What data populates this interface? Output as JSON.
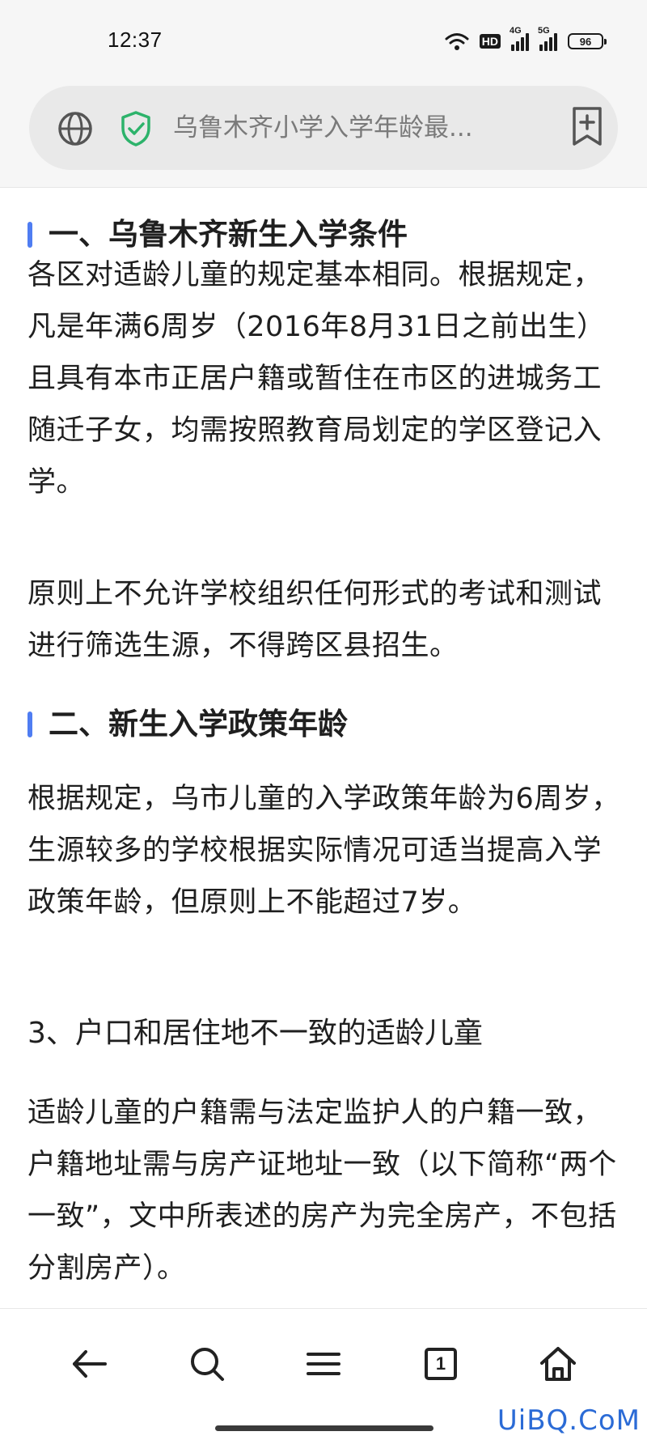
{
  "status_bar": {
    "time": "12:37",
    "hd_badge": "HD",
    "network_1": "4G",
    "network_2": "5G",
    "battery": "96"
  },
  "address_bar": {
    "page_title": "乌鲁木齐小学入学年龄最...",
    "icons": [
      "globe-icon",
      "security-shield-icon",
      "bookmark-add-icon"
    ],
    "shield_color": "#2db36b"
  },
  "article": {
    "sections": [
      {
        "heading": "一、乌鲁木齐新生入学条件",
        "paragraphs": [
          "各区对适龄儿童的规定基本相同。根据规定，凡是年满6周岁（2016年8月31日之前出生）且具有本市正居户籍或暂住在市区的进城务工随迁子女，均需按照教育局划定的学区登记入学。",
          "原则上不允许学校组织任何形式的考试和测试进行筛选生源，不得跨区县招生。"
        ]
      },
      {
        "heading": "二、新生入学政策年龄",
        "paragraphs": [
          "根据规定，乌市儿童的入学政策年龄为6周岁，生源较多的学校根据实际情况可适当提高入学政策年龄，但原则上不能超过7岁。"
        ]
      },
      {
        "heading": "3、户口和居住地不一致的适龄儿童",
        "paragraphs": [
          "适龄儿童的户籍需与法定监护人的户籍一致，户籍地址需与房产证地址一致（以下简称“两个一致”，文中所表述的房产为完全房产，不包括分割房产）。"
        ]
      }
    ],
    "accent_color": "#4f7df2"
  },
  "bottom_nav": {
    "icons": [
      "back-arrow-icon",
      "search-icon",
      "menu-icon",
      "tabs-icon",
      "home-icon"
    ],
    "tab_count": "1"
  },
  "watermark": "UiBQ.CoM"
}
